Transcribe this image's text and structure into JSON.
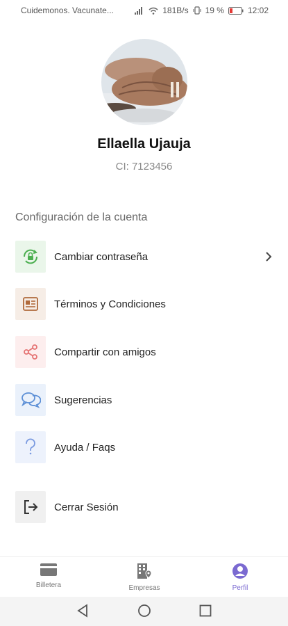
{
  "status_bar": {
    "carrier": "Cuidemonos. Vacunate...",
    "speed": "181B/s",
    "battery": "19 %",
    "time": "12:02"
  },
  "profile": {
    "name": "Ellaella Ujauja",
    "id_text": "CI: 7123456"
  },
  "section_title": "Configuración de la cuenta",
  "menu": [
    {
      "label": "Cambiar contraseña",
      "icon": "lock-refresh-icon",
      "color": "#4caf50"
    },
    {
      "label": "Términos y Condiciones",
      "icon": "document-icon",
      "color": "#b06a3b"
    },
    {
      "label": "Compartir con amigos",
      "icon": "share-icon",
      "color": "#e57373"
    },
    {
      "label": "Sugerencias",
      "icon": "chat-bubbles-icon",
      "color": "#5c8fd6"
    },
    {
      "label": "Ayuda / Faqs",
      "icon": "question-icon",
      "color": "#7a9ae0"
    },
    {
      "label": "Cerrar Sesión",
      "icon": "logout-icon",
      "color": "#333333"
    }
  ],
  "bottom_nav": [
    {
      "label": "Billetera",
      "icon": "wallet-card-icon",
      "active": false
    },
    {
      "label": "Empresas",
      "icon": "building-location-icon",
      "active": false
    },
    {
      "label": "Perfil",
      "icon": "user-circle-icon",
      "active": true
    }
  ],
  "colors": {
    "accent": "#7b6ad1"
  }
}
